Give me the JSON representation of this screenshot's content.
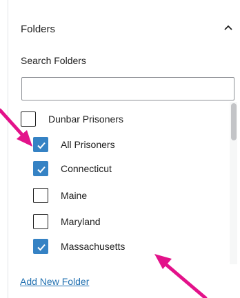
{
  "panel": {
    "title": "Folders",
    "toggle_icon": "chevron-up-icon"
  },
  "search": {
    "label": "Search Folders",
    "value": "",
    "placeholder": ""
  },
  "folders": [
    {
      "label": "Dunbar Prisoners",
      "checked": false,
      "level": 0
    },
    {
      "label": "All Prisoners",
      "checked": true,
      "level": 1
    },
    {
      "label": "Connecticut",
      "checked": true,
      "level": 1
    },
    {
      "label": "Maine",
      "checked": false,
      "level": 1
    },
    {
      "label": "Maryland",
      "checked": false,
      "level": 1
    },
    {
      "label": "Massachusetts",
      "checked": true,
      "level": 1
    }
  ],
  "footer": {
    "add_label": "Add New Folder"
  },
  "colors": {
    "accent": "#3582c4",
    "link": "#2271b1",
    "annotation_arrow": "#e3128a"
  },
  "annotations": {
    "arrow_icon": "pink-annotation-arrow-icon"
  }
}
